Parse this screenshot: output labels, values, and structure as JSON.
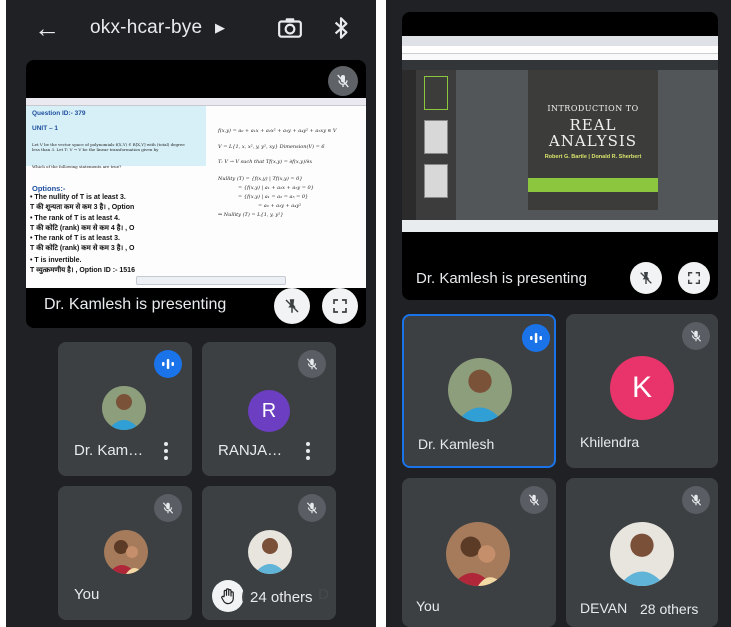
{
  "left_phone": {
    "header": {
      "title": "okx-hcar-bye"
    },
    "presentation": {
      "label": "Dr. Kamlesh is presenting",
      "slide": {
        "q_header": "Question ID:- 379",
        "unit": "UNIT – 1",
        "question": "Let V be the vector space of polynomials f(X,Y) ∈ R[X,Y] with (total) degree less than 3. Let T: V → V be the linear transformation given by",
        "which": "Which of the following statements are true?",
        "options_head": "Options:-",
        "opt1_en": "• The nullity of T is at least 3.",
        "opt1_hi": "T की शून्यता कम से कम 3 है। , Option",
        "opt2_en": "• The rank of T is at least 4.",
        "opt2_hi": "T की कोटि (rank) कम से कम 4 है। , O",
        "opt3_en": "• The rank of T is at least 3.",
        "opt3_hi": "T की कोटि (rank) कम से कम 3 है। , O",
        "opt4_en": "• T is invertible.",
        "opt4_hi": "T व्युत्क्रमणीय है। , Option ID :- 1516",
        "math1": "f(x,y) = a₀ + a₁x + a₂x² + a₃y + a₄y² + a₅xy ∈ V",
        "math2": "V = L{1, x, x², y, y², xy}     Dimension(V) = 6",
        "math3": "T: V → V such that   Tf(x,y) = ∂f(x,y)/∂x",
        "math4": "Nullity (T) = {f(x,y) | Tf(x,y) = 0}",
        "math5": "= {f(x,y) | a₁ + a₂x + a₅y = 0}",
        "math6": "= {f(x,y) | a₁ = a₂ = a₅ = 0}",
        "math7": "= a₀ + a₃y + a₄y²",
        "math8": "⇒ Nullity (T) = L{1, y, y²}"
      }
    },
    "participants": [
      {
        "name": "Dr. Kam…",
        "speaking": true
      },
      {
        "name": "RANJA…",
        "initial": "R",
        "color": "#6c3ec1"
      },
      {
        "name": "You"
      },
      {
        "name": "D"
      }
    ],
    "others": "24 others"
  },
  "right_phone": {
    "presentation": {
      "label": "Dr. Kamlesh is presenting",
      "book": {
        "line1": "INTRODUCTION TO",
        "line2": "REAL",
        "line3": "ANALYSIS",
        "authors": "Robert G. Bartle  |  Donald R. Sherbert"
      }
    },
    "participants": [
      {
        "name": "Dr. Kamlesh",
        "speaking": true
      },
      {
        "name": "Khilendra",
        "initial": "K",
        "color": "#e8336b"
      },
      {
        "name": "You"
      },
      {
        "name": "DEVAN"
      }
    ],
    "others": "28 others"
  },
  "icons": {
    "back": "arrow-left",
    "switch_camera": "camera-switch",
    "bluetooth": "bluetooth",
    "mic_off": "mic-off",
    "speaking": "audio-bars",
    "unpin": "pin-off",
    "fullscreen": "fullscreen",
    "more": "more-vertical",
    "raise_hand": "hand"
  }
}
